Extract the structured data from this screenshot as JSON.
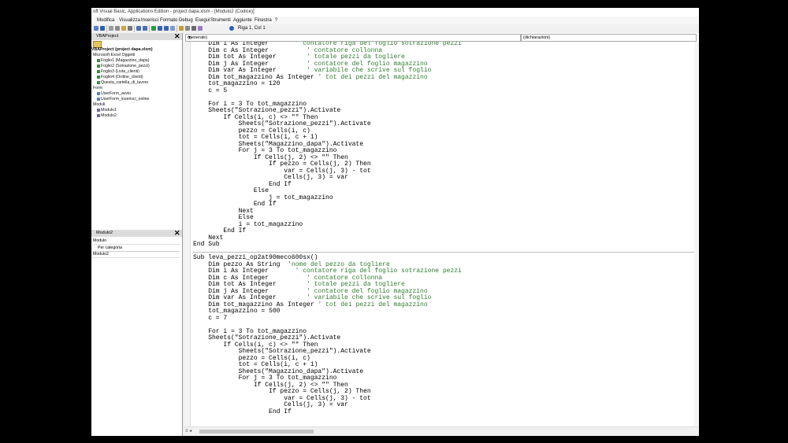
{
  "window": {
    "title": "oft Visual Basic, Applications Edition - project dapa.xlsm - [Modulo2 (Codice)]"
  },
  "menu": [
    "Modifica",
    "Visualizza",
    "Inserisci",
    "Formato",
    "Debug",
    "Esegui",
    "Strumenti",
    "Aggiunte",
    "Finestra",
    "?"
  ],
  "toolbar": {
    "position": "Riga 1, Col 1"
  },
  "project_pane": {
    "title": "VBAProject",
    "root": "VBAProject (project dapa.xlsm)",
    "group_objects": "Microsoft Excel Oggetti",
    "sheets": [
      "Foglio1 (Magazzino_dapa)",
      "Foglio2 (Sotrazione_pezzi)",
      "Foglio3 (Lista_clienti)",
      "Foglio4 (Ordine_clienti)",
      "Questa_cartella_di_lavoro"
    ],
    "group_forms": "Form",
    "forms": [
      "UserForm_avvio",
      "UserForm_inserisci_online"
    ],
    "group_modules": "Moduli",
    "modules": [
      "Modulo1",
      "Modulo2"
    ]
  },
  "properties_pane": {
    "title": "Modulo2",
    "object": "Modulo",
    "tab": "Per categoria",
    "row": "Modulo2"
  },
  "editor": {
    "object_combo": "(generale)",
    "proc_combo": "(dichiarazioni)",
    "lines": [
      {
        "t": "    Dim i As Integer       ",
        "c": "' contatore riga del foglio sotrazione pezzi"
      },
      {
        "t": "    Dim c As Integer          ",
        "c": "' contatore collonna"
      },
      {
        "t": "    Dim tot As Integer        ",
        "c": "' totale pezzi da togliere"
      },
      {
        "t": "    Dim j As Integer          ",
        "c": "' contatore del foglio magazzino"
      },
      {
        "t": "    Dim var As Integer        ",
        "c": "' variabile che scrive sul foglio"
      },
      {
        "t": "    Dim tot_magazzino As Integer ",
        "c": "' tot dei pezzi del magazzino"
      },
      {
        "t": "    tot_magazzino = 120",
        "c": ""
      },
      {
        "t": "    c = 5",
        "c": ""
      },
      {
        "t": "",
        "c": ""
      },
      {
        "t": "    For i = 3 To tot_magazzino",
        "c": ""
      },
      {
        "t": "    Sheets(\"Sotrazione_pezzi\").Activate",
        "c": ""
      },
      {
        "t": "        If Cells(i, c) <> \"\" Then",
        "c": ""
      },
      {
        "t": "            Sheets(\"Sotrazione_pezzi\").Activate",
        "c": ""
      },
      {
        "t": "            pezzo = Cells(i, c)",
        "c": ""
      },
      {
        "t": "            tot = Cells(i, c + 1)",
        "c": ""
      },
      {
        "t": "            Sheets(\"Magazzino_dapa\").Activate",
        "c": ""
      },
      {
        "t": "            For j = 3 To tot_magazzino",
        "c": ""
      },
      {
        "t": "                If Cells(j, 2) <> \"\" Then",
        "c": ""
      },
      {
        "t": "                    If pezzo = Cells(j, 2) Then",
        "c": ""
      },
      {
        "t": "                        var = Cells(j, 3) - tot",
        "c": ""
      },
      {
        "t": "                        Cells(j, 3) = var",
        "c": ""
      },
      {
        "t": "                    End If",
        "c": ""
      },
      {
        "t": "                Else",
        "c": ""
      },
      {
        "t": "                    j = tot_magazzino",
        "c": ""
      },
      {
        "t": "                End If",
        "c": ""
      },
      {
        "t": "            Next",
        "c": ""
      },
      {
        "t": "            Else",
        "c": ""
      },
      {
        "t": "            i = tot_magazzino",
        "c": ""
      },
      {
        "t": "        End If",
        "c": ""
      },
      {
        "t": "    Next",
        "c": ""
      },
      {
        "t": "End Sub",
        "c": ""
      },
      {
        "t": "",
        "c": "",
        "divider": true
      },
      {
        "t": "Sub leva_pezzi_op2at90meco600sx()",
        "c": ""
      },
      {
        "t": "    Dim pezzo As String  ",
        "c": "'nome del pezzo da togliere"
      },
      {
        "t": "    Dim i As Integer       ",
        "c": "' contatore riga del foglio sotrazione pezzi"
      },
      {
        "t": "    Dim c As Integer          ",
        "c": "' contatore collonna"
      },
      {
        "t": "    Dim tot As Integer        ",
        "c": "' totale pezzi da togliere"
      },
      {
        "t": "    Dim j As Integer          ",
        "c": "' contatore del foglio magazzino"
      },
      {
        "t": "    Dim var As Integer        ",
        "c": "' variabile che scrive sul foglio"
      },
      {
        "t": "    Dim tot_magazzino As Integer ",
        "c": "' tot dei pezzi del magazzino"
      },
      {
        "t": "    tot_magazzino = 500",
        "c": ""
      },
      {
        "t": "    c = 7",
        "c": ""
      },
      {
        "t": "",
        "c": ""
      },
      {
        "t": "    For i = 3 To tot_magazzino",
        "c": ""
      },
      {
        "t": "    Sheets(\"Sotrazione_pezzi\").Activate",
        "c": ""
      },
      {
        "t": "        If Cells(i, c) <> \"\" Then",
        "c": ""
      },
      {
        "t": "            Sheets(\"Sotrazione_pezzi\").Activate",
        "c": ""
      },
      {
        "t": "            pezzo = Cells(i, c)",
        "c": ""
      },
      {
        "t": "            tot = Cells(i, c + 1)",
        "c": ""
      },
      {
        "t": "            Sheets(\"Magazzino_dapa\").Activate",
        "c": ""
      },
      {
        "t": "            For j = 3 To tot_magazzino",
        "c": ""
      },
      {
        "t": "                If Cells(j, 2) <> \"\" Then",
        "c": ""
      },
      {
        "t": "                    If pezzo = Cells(j, 2) Then",
        "c": ""
      },
      {
        "t": "                        var = Cells(j, 3) - tot",
        "c": ""
      },
      {
        "t": "                        Cells(j, 3) = var",
        "c": ""
      },
      {
        "t": "                    End If",
        "c": ""
      }
    ]
  },
  "colors": {
    "comment": "#2f7d2f",
    "code": "#000000",
    "background": "#ffffff"
  }
}
